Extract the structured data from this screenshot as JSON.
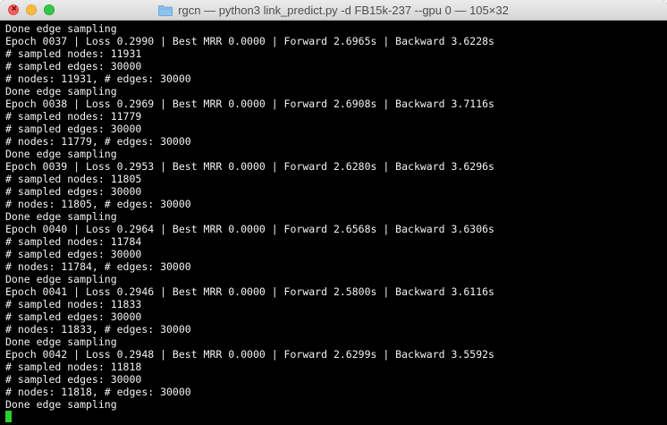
{
  "window": {
    "title": "rgcn — python3 link_predict.py -d FB15k-237 --gpu 0 — 105×32",
    "close_symbol": "×",
    "colors": {
      "close": "#fc605c",
      "minimize": "#fdbc40",
      "zoom": "#34c84a",
      "background": "#000000",
      "text": "#f2f2f2",
      "cursor": "#2ad12a"
    }
  },
  "terminal": {
    "lines": [
      "Done edge sampling",
      "Epoch 0037 | Loss 0.2990 | Best MRR 0.0000 | Forward 2.6965s | Backward 3.6228s",
      "# sampled nodes: 11931",
      "# sampled edges: 30000",
      "# nodes: 11931, # edges: 30000",
      "Done edge sampling",
      "Epoch 0038 | Loss 0.2969 | Best MRR 0.0000 | Forward 2.6908s | Backward 3.7116s",
      "# sampled nodes: 11779",
      "# sampled edges: 30000",
      "# nodes: 11779, # edges: 30000",
      "Done edge sampling",
      "Epoch 0039 | Loss 0.2953 | Best MRR 0.0000 | Forward 2.6280s | Backward 3.6296s",
      "# sampled nodes: 11805",
      "# sampled edges: 30000",
      "# nodes: 11805, # edges: 30000",
      "Done edge sampling",
      "Epoch 0040 | Loss 0.2964 | Best MRR 0.0000 | Forward 2.6568s | Backward 3.6306s",
      "# sampled nodes: 11784",
      "# sampled edges: 30000",
      "# nodes: 11784, # edges: 30000",
      "Done edge sampling",
      "Epoch 0041 | Loss 0.2946 | Best MRR 0.0000 | Forward 2.5800s | Backward 3.6116s",
      "# sampled nodes: 11833",
      "# sampled edges: 30000",
      "# nodes: 11833, # edges: 30000",
      "Done edge sampling",
      "Epoch 0042 | Loss 0.2948 | Best MRR 0.0000 | Forward 2.6299s | Backward 3.5592s",
      "# sampled nodes: 11818",
      "# sampled edges: 30000",
      "# nodes: 11818, # edges: 30000",
      "Done edge sampling"
    ]
  }
}
